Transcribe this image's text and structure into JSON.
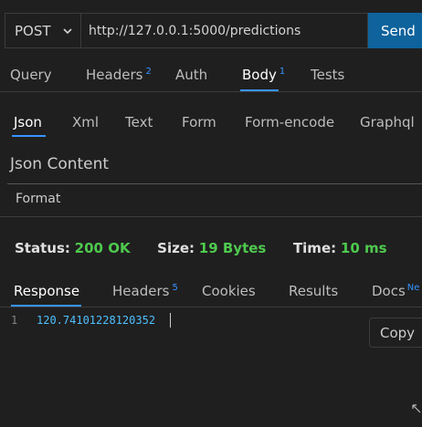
{
  "request": {
    "method": "POST",
    "url": "http://127.0.0.1:5000/predictions",
    "send_label": "Send"
  },
  "request_tabs": {
    "query": "Query",
    "headers": "Headers",
    "headers_count": "2",
    "auth": "Auth",
    "body": "Body",
    "body_count": "1",
    "tests": "Tests"
  },
  "body_tabs": {
    "json": "Json",
    "xml": "Xml",
    "text": "Text",
    "form": "Form",
    "form_encode": "Form-encode",
    "graphql": "Graphql"
  },
  "body": {
    "section_title": "Json Content",
    "format_label": "Format"
  },
  "status": {
    "status_label": "Status:",
    "status_value": "200 OK",
    "size_label": "Size:",
    "size_value": "19 Bytes",
    "time_label": "Time:",
    "time_value": "10 ms"
  },
  "response_tabs": {
    "response": "Response",
    "headers": "Headers",
    "headers_count": "5",
    "cookies": "Cookies",
    "results": "Results",
    "docs": "Docs",
    "docs_badge": "Ne"
  },
  "response": {
    "line_number": "1",
    "value": "120.74101228120352",
    "copy_label": "Copy"
  },
  "colors": {
    "background": "#1f1f1f",
    "accent": "#3794ff",
    "send_button": "#0e639c",
    "success": "#4ec94e"
  }
}
